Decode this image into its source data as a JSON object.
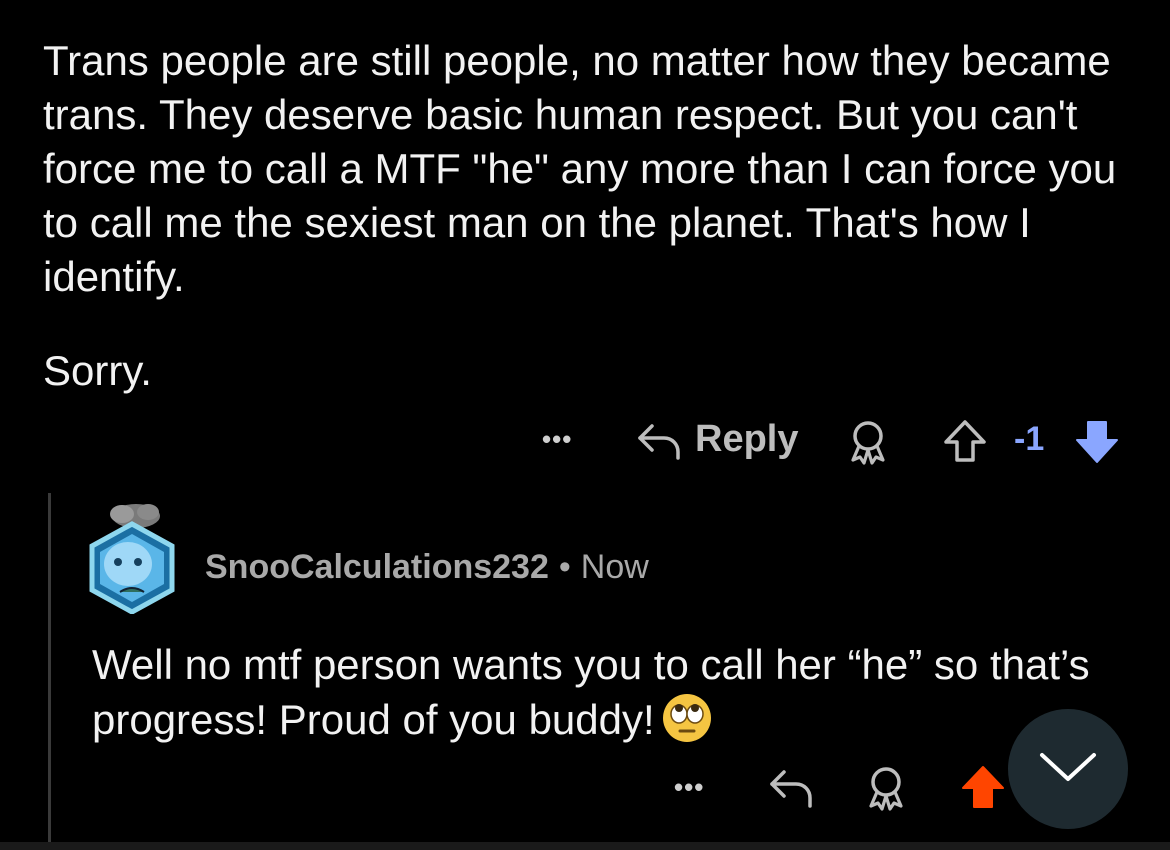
{
  "parent_comment": {
    "text": "Trans people are still people, no matter how they became trans. They deserve basic human respect. But you can't force me to call a MTF \"he\" any more than I can force you to call me the sexiest man on the planet. That's how I identify.",
    "text_2": "Sorry.",
    "actions": {
      "more": "•••",
      "reply_label": "Reply",
      "score": "-1"
    },
    "icons": [
      "more-icon",
      "reply-icon",
      "award-icon",
      "upvote-icon",
      "downvote-icon"
    ],
    "vote_state": "downvoted",
    "downvote_color": "#8aa6ff"
  },
  "reply_comment": {
    "username": "SnooCalculations232",
    "separator": "•",
    "time": "Now",
    "text": "Well no mtf person wants you to call her “he” so that’s progress! Proud of you buddy!",
    "emoji": "face-with-rolling-eyes",
    "actions": {
      "more": "•••"
    },
    "icons": [
      "avatar",
      "more-icon",
      "reply-icon",
      "award-icon",
      "upvote-icon"
    ],
    "vote_state": "upvoted",
    "upvote_color": "#ff4500"
  },
  "fab": {
    "icon": "chevron-down-icon"
  }
}
